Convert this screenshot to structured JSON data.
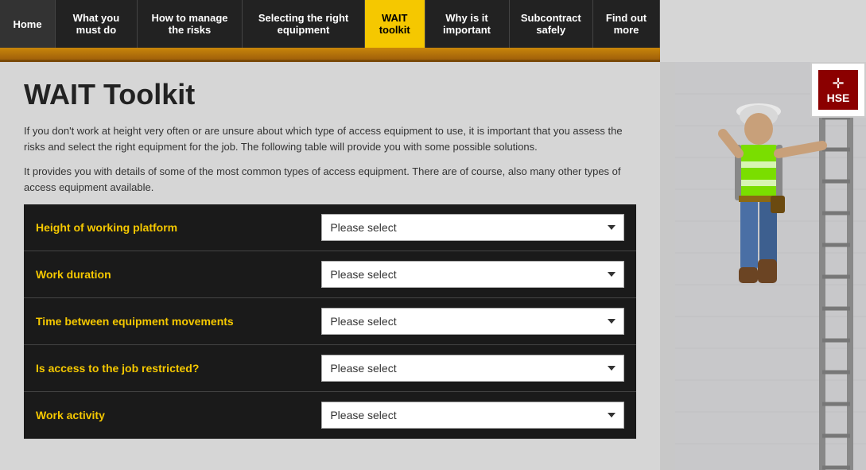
{
  "nav": {
    "items": [
      {
        "label": "Home",
        "active": false
      },
      {
        "label": "What you must do",
        "active": false
      },
      {
        "label": "How to manage the risks",
        "active": false
      },
      {
        "label": "Selecting the right equipment",
        "active": false
      },
      {
        "label": "WAIT toolkit",
        "active": true
      },
      {
        "label": "Why is it important",
        "active": false
      },
      {
        "label": "Subcontract safely",
        "active": false
      },
      {
        "label": "Find out more",
        "active": false
      }
    ]
  },
  "page": {
    "title": "WAIT Toolkit",
    "description1": "If you don't work at height very often or are unsure about which type of access equipment to use, it is important that you assess the risks and select the right equipment for the job. The following table will provide you with some possible solutions.",
    "description2": "It provides you with details of some of the most common types of access equipment. There are of course, also many other types of access equipment available."
  },
  "toolkit": {
    "rows": [
      {
        "label": "Height of working platform",
        "placeholder": "Please select"
      },
      {
        "label": "Work duration",
        "placeholder": "Please select"
      },
      {
        "label": "Time between equipment movements",
        "placeholder": "Please select"
      },
      {
        "label": "Is access to the job restricted?",
        "placeholder": "Please select"
      },
      {
        "label": "Work activity",
        "placeholder": "Please select"
      }
    ]
  },
  "hse": {
    "logo_text": "HSE"
  }
}
